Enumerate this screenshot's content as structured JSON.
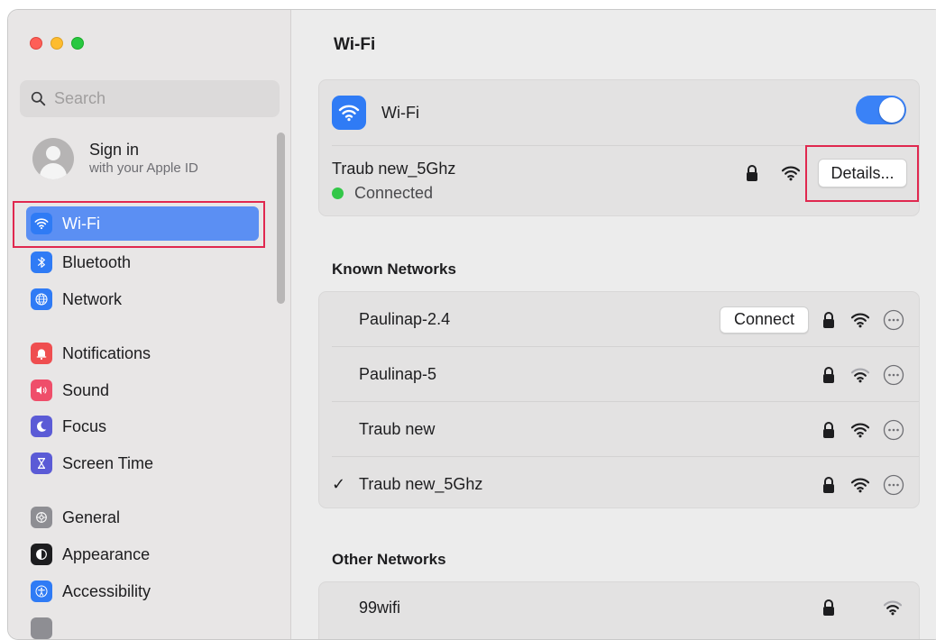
{
  "sidebar": {
    "search": {
      "placeholder": "Search",
      "value": ""
    },
    "account": {
      "title": "Sign in",
      "subtitle": "with your Apple ID"
    },
    "items": [
      {
        "label": "Wi-Fi",
        "icon": "wifi-icon",
        "color": "#2f7bf5",
        "active": true
      },
      {
        "label": "Bluetooth",
        "icon": "bluetooth-icon",
        "color": "#2f7bf5",
        "active": false
      },
      {
        "label": "Network",
        "icon": "globe-icon",
        "color": "#2f7bf5",
        "active": false
      },
      {
        "label": "Notifications",
        "icon": "bell-icon",
        "color": "#ef4e50",
        "active": false
      },
      {
        "label": "Sound",
        "icon": "speaker-icon",
        "color": "#ef4e6a",
        "active": false
      },
      {
        "label": "Focus",
        "icon": "moon-icon",
        "color": "#5b5bd6",
        "active": false
      },
      {
        "label": "Screen Time",
        "icon": "hourglass-icon",
        "color": "#5b5bd6",
        "active": false
      },
      {
        "label": "General",
        "icon": "gear-icon",
        "color": "#8e8e93",
        "active": false
      },
      {
        "label": "Appearance",
        "icon": "appearance-icon",
        "color": "#1d1d1f",
        "active": false
      },
      {
        "label": "Accessibility",
        "icon": "accessibility-icon",
        "color": "#2f7bf5",
        "active": false
      }
    ]
  },
  "main": {
    "title": "Wi-Fi",
    "wifi_toggle": {
      "label": "Wi-Fi",
      "on": true
    },
    "current_network": {
      "name": "Traub new_5Ghz",
      "status": "Connected",
      "details_label": "Details..."
    },
    "known_networks_title": "Known Networks",
    "known_networks": [
      {
        "name": "Paulinap-2.4",
        "connect_label": "Connect",
        "checked": false,
        "signal": "full"
      },
      {
        "name": "Paulinap-5",
        "checked": false,
        "signal": "weak"
      },
      {
        "name": "Traub new",
        "checked": false,
        "signal": "full"
      },
      {
        "name": "Traub new_5Ghz",
        "checked": true,
        "check_mark": "✓",
        "signal": "full"
      }
    ],
    "other_networks_title": "Other Networks",
    "other_networks": [
      {
        "name": "99wifi",
        "signal": "weak"
      }
    ]
  },
  "colors": {
    "accent": "#3a82f7",
    "highlight_annotation": "#e0284f",
    "connected": "#33c748"
  }
}
